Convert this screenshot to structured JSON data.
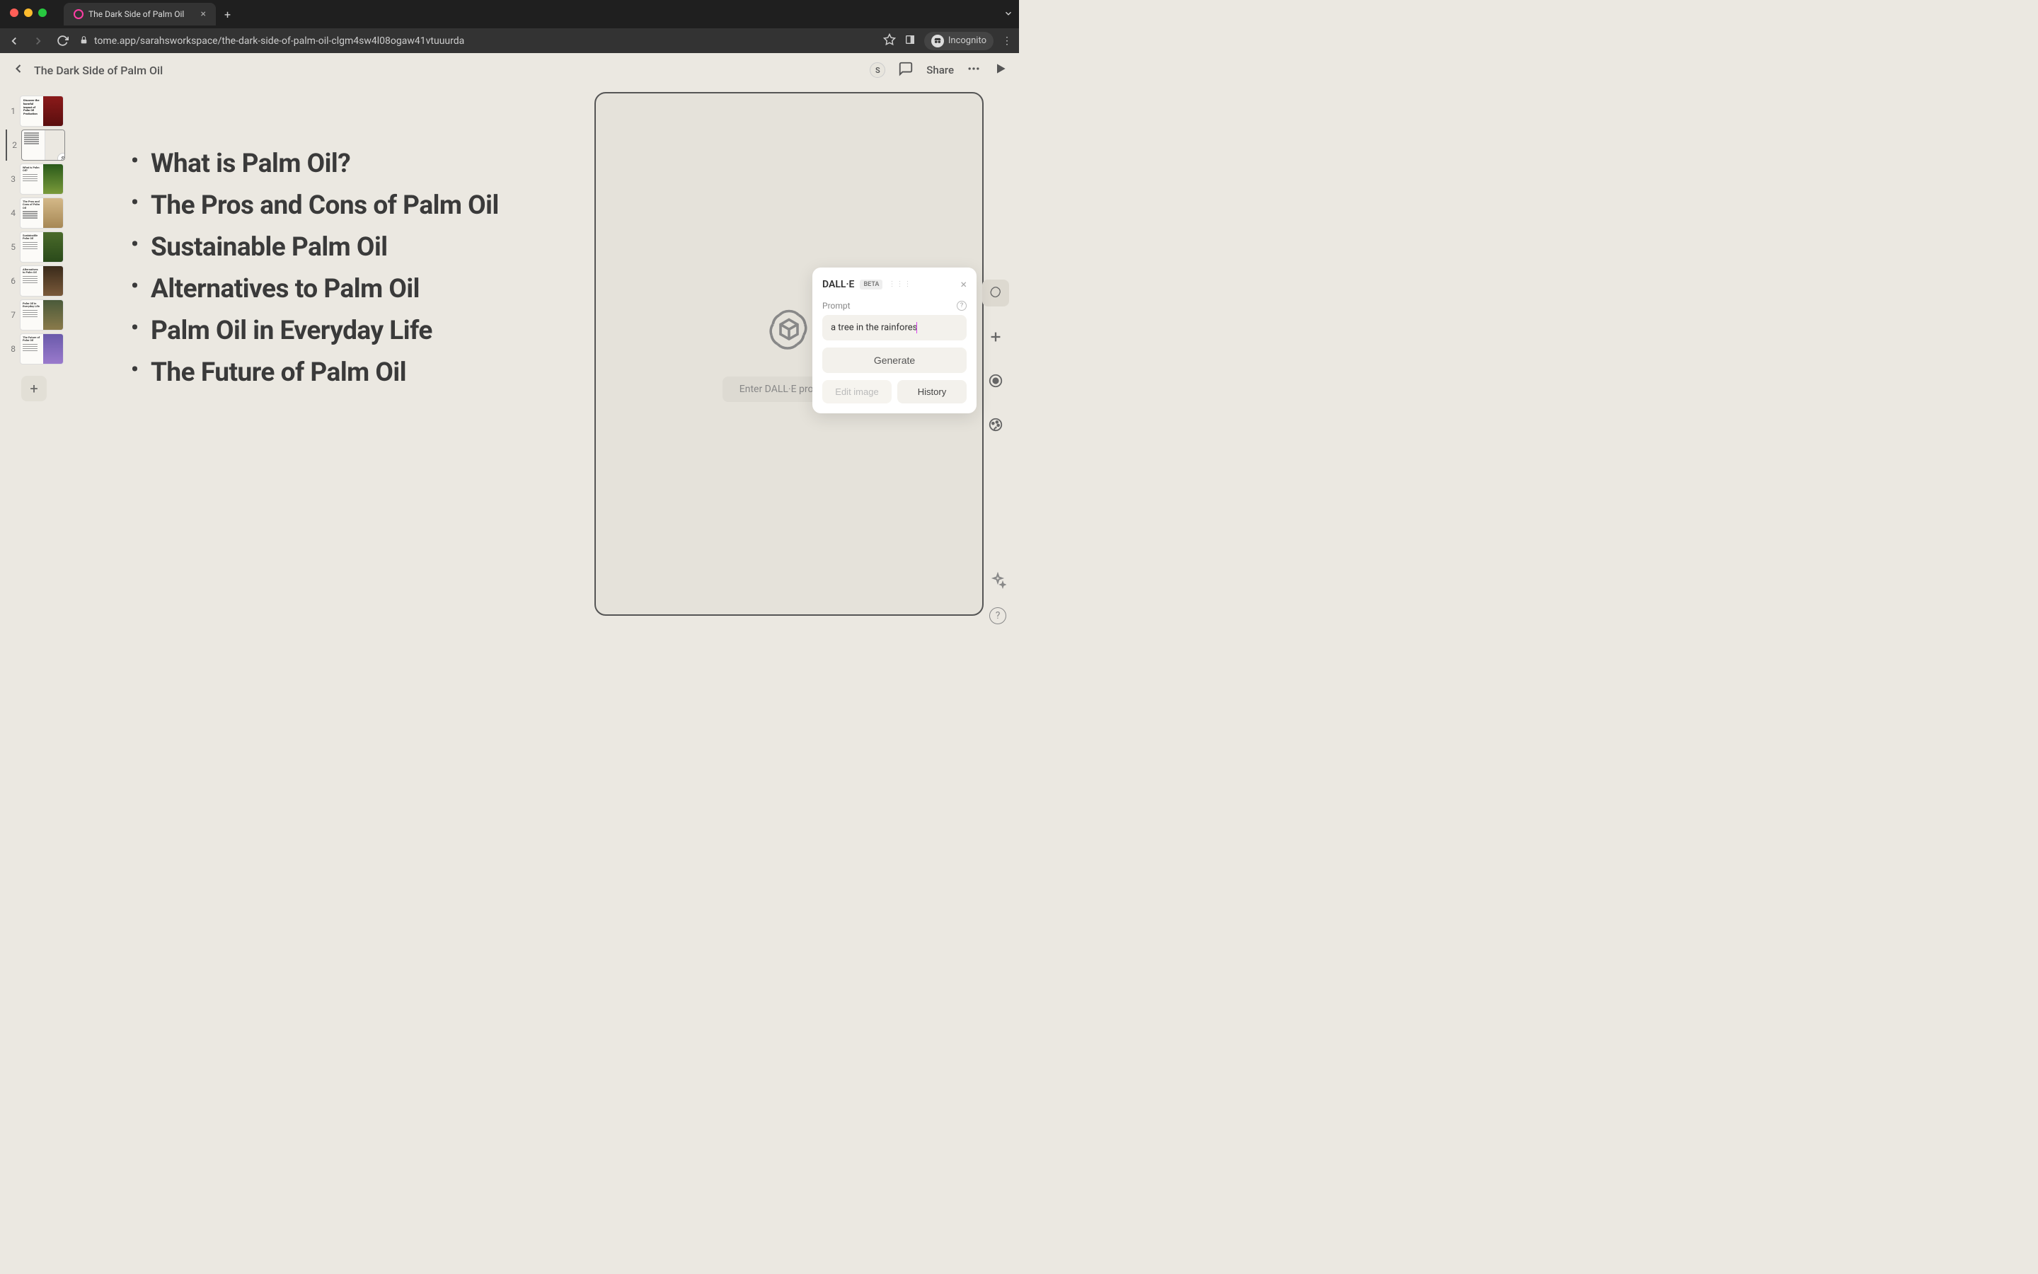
{
  "browser": {
    "tab_title": "The Dark Side of Palm Oil",
    "url": "tome.app/sarahsworkspace/the-dark-side-of-palm-oil-clgm4sw4l08ogaw41vtuuurda",
    "incognito_label": "Incognito"
  },
  "header": {
    "title": "The Dark Side of Palm Oil",
    "share_label": "Share",
    "avatar_initial": "S"
  },
  "slides": {
    "items": [
      {
        "num": "1",
        "title": "Discover the harmful impact of Palm Oil Production"
      },
      {
        "num": "2",
        "title": ""
      },
      {
        "num": "3",
        "title": "What is Palm Oil?"
      },
      {
        "num": "4",
        "title": "The Pros and Cons of Palm Oil"
      },
      {
        "num": "5",
        "title": "Sustainable Palm Oil"
      },
      {
        "num": "6",
        "title": "Alternatives to Palm Oil"
      },
      {
        "num": "7",
        "title": "Palm Oil in Everyday Life"
      },
      {
        "num": "8",
        "title": "The Future of Palm Oil"
      }
    ],
    "active_index": 1,
    "collaborator_initial": "S"
  },
  "content": {
    "bullets": [
      "What is Palm Oil?",
      "The Pros and Cons of Palm Oil",
      "Sustainable Palm Oil",
      "Alternatives to Palm Oil",
      "Palm Oil in Everyday Life",
      "The Future of Palm Oil"
    ]
  },
  "image_tile": {
    "placeholder": "Enter DALL·E prompt..."
  },
  "dalle": {
    "title": "DALL·E",
    "badge": "BETA",
    "prompt_label": "Prompt",
    "prompt_value": "a tree in the rainfores",
    "generate_label": "Generate",
    "edit_label": "Edit image",
    "history_label": "History"
  }
}
